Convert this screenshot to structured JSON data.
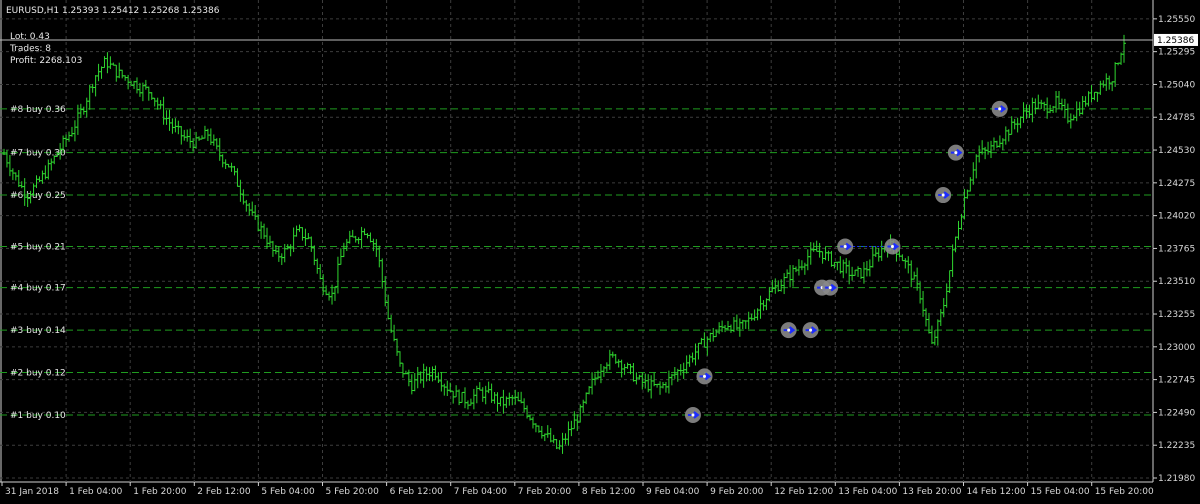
{
  "header": {
    "symbol_line": "EURUSD,H1  1.25393 1.25412 1.25268 1.25386",
    "lot": "Lot: 0.43",
    "trades": "Trades: 8",
    "profit": "Profit: 2268.103"
  },
  "colors": {
    "background": "#000000",
    "bar": "#2fd62f",
    "grid": "#3d3d3d",
    "level_line": "#1f9b1f",
    "entry_marker": "#8a8a8a",
    "entry_arrow": "#1c2bff",
    "price_tag_bg": "#ffffff",
    "axis_text": "#d8d8d8"
  },
  "chart_data": {
    "type": "ohlc",
    "title": "EURUSD,H1",
    "last_price": "1.25386",
    "ylim": [
      1.2198,
      1.2558
    ],
    "y_ticks": [
      "1.25550",
      "1.25295",
      "1.25040",
      "1.24785",
      "1.24530",
      "1.24275",
      "1.24020",
      "1.23765",
      "1.23510",
      "1.23255",
      "1.23000",
      "1.22745",
      "1.22490",
      "1.22235",
      "1.21980"
    ],
    "x_ticks": [
      "31 Jan 2018",
      "1 Feb 04:00",
      "1 Feb 20:00",
      "2 Feb 12:00",
      "5 Feb 04:00",
      "5 Feb 20:00",
      "6 Feb 12:00",
      "7 Feb 04:00",
      "7 Feb 20:00",
      "8 Feb 12:00",
      "9 Feb 04:00",
      "9 Feb 20:00",
      "12 Feb 12:00",
      "13 Feb 04:00",
      "13 Feb 20:00",
      "14 Feb 12:00",
      "15 Feb 04:00",
      "15 Feb 20:00"
    ],
    "close_path": [
      1.245,
      1.2432,
      1.2418,
      1.2427,
      1.244,
      1.2455,
      1.2468,
      1.2486,
      1.251,
      1.2522,
      1.2513,
      1.2508,
      1.2502,
      1.2498,
      1.2482,
      1.247,
      1.2462,
      1.2458,
      1.2466,
      1.245,
      1.244,
      1.242,
      1.24,
      1.2388,
      1.237,
      1.2375,
      1.239,
      1.2383,
      1.235,
      1.234,
      1.2378,
      1.2385,
      1.2392,
      1.2375,
      1.232,
      1.2285,
      1.227,
      1.2278,
      1.2282,
      1.227,
      1.2262,
      1.2258,
      1.2265,
      1.2262,
      1.2256,
      1.226,
      1.2252,
      1.224,
      1.223,
      1.222,
      1.2235,
      1.225,
      1.2272,
      1.2288,
      1.2292,
      1.2284,
      1.2274,
      1.227,
      1.2268,
      1.2276,
      1.2285,
      1.2295,
      1.2305,
      1.2312,
      1.2318,
      1.2314,
      1.2322,
      1.2335,
      1.2345,
      1.2352,
      1.236,
      1.237,
      1.2375,
      1.2368,
      1.2362,
      1.2356,
      1.2358,
      1.237,
      1.238,
      1.2375,
      1.236,
      1.234,
      1.23,
      1.233,
      1.238,
      1.242,
      1.245,
      1.2452,
      1.2462,
      1.247,
      1.248,
      1.2488,
      1.2486,
      1.249,
      1.2478,
      1.2485,
      1.2495,
      1.2505,
      1.251,
      1.2538
    ],
    "levels": [
      {
        "label": "#8 buy 0.36",
        "price": 1.2485
      },
      {
        "label": "#7 buy 0.30",
        "price": 1.2451
      },
      {
        "label": "#6 buy 0.25",
        "price": 1.2418
      },
      {
        "label": "#5 buy 0.21",
        "price": 1.2378
      },
      {
        "label": "#4 buy 0.17",
        "price": 1.2346
      },
      {
        "label": "#3 buy 0.14",
        "price": 1.2313
      },
      {
        "label": "#2 buy 0.12",
        "price": 1.228
      },
      {
        "label": "#1 buy 0.10",
        "price": 1.2247
      }
    ],
    "entries": [
      {
        "x": 0.601,
        "price": 1.2247
      },
      {
        "x": 0.611,
        "price": 1.2277
      },
      {
        "x": 0.684,
        "price": 1.2313
      },
      {
        "x": 0.703,
        "price": 1.2313
      },
      {
        "x": 0.713,
        "price": 1.2346
      },
      {
        "x": 0.72,
        "price": 1.2346
      },
      {
        "x": 0.733,
        "price": 1.2378
      },
      {
        "x": 0.774,
        "price": 1.2378
      },
      {
        "x": 0.818,
        "price": 1.2418
      },
      {
        "x": 0.829,
        "price": 1.2451
      },
      {
        "x": 0.867,
        "price": 1.2485
      }
    ],
    "connector": {
      "from_x": 0.733,
      "to_x": 0.774,
      "price": 1.2378
    }
  }
}
